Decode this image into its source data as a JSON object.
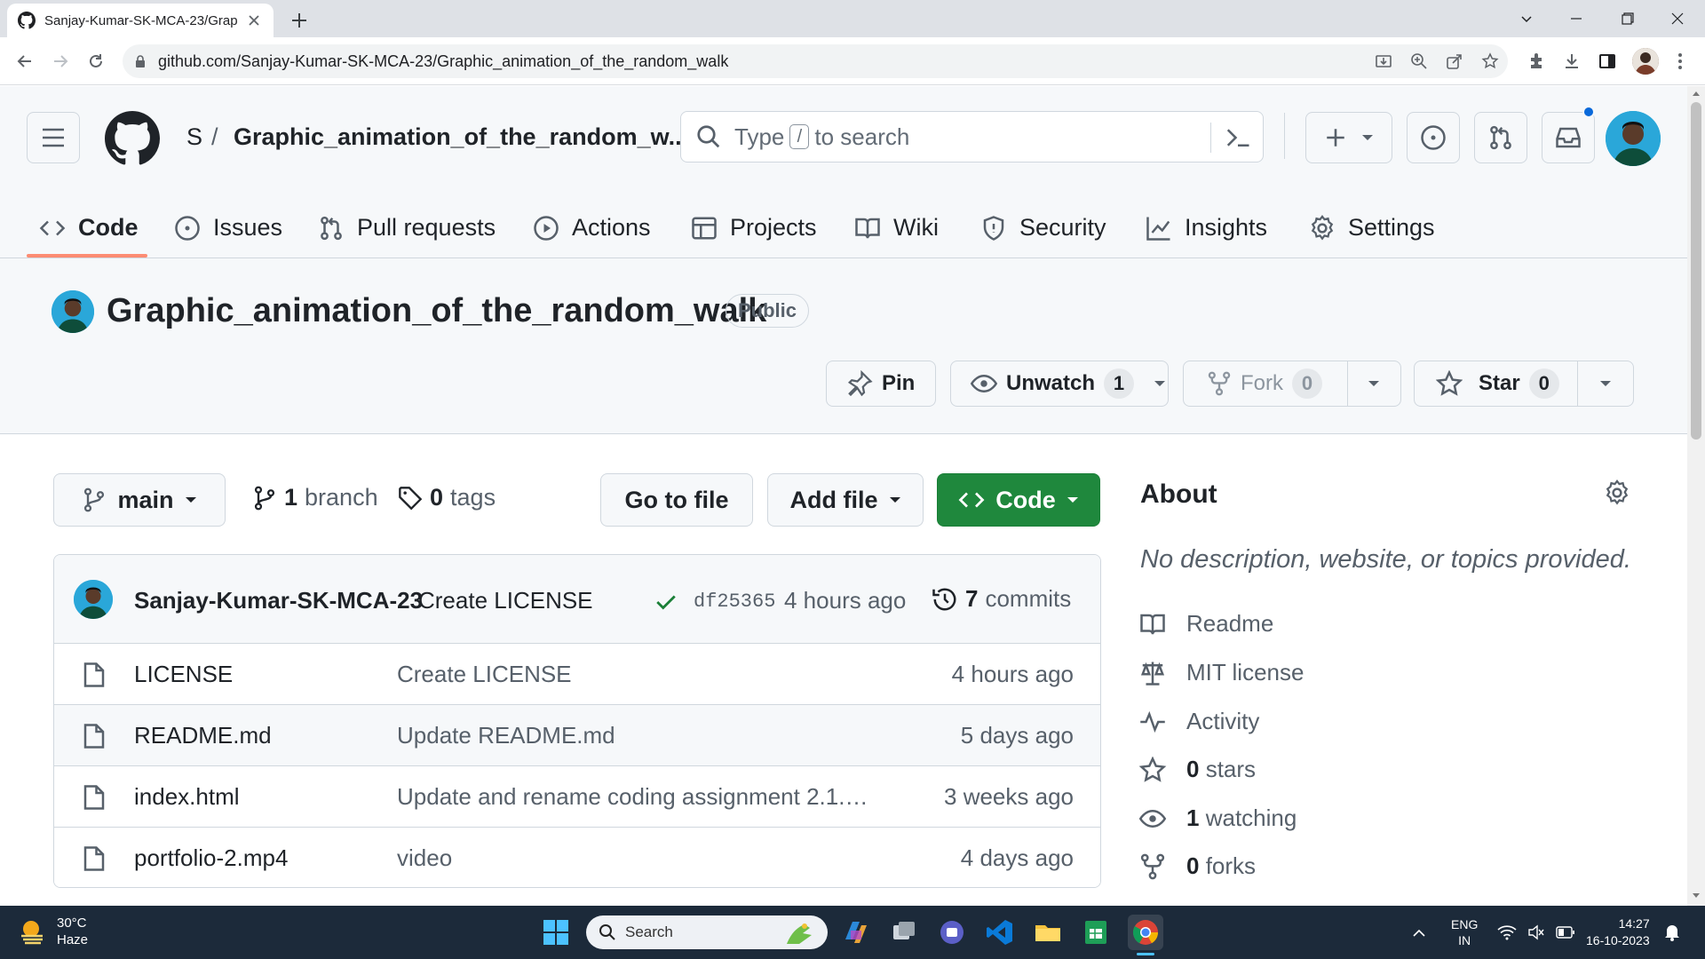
{
  "browser": {
    "tab_title": "Sanjay-Kumar-SK-MCA-23/Grap",
    "url": "github.com/Sanjay-Kumar-SK-MCA-23/Graphic_animation_of_the_random_walk"
  },
  "header": {
    "owner": "S",
    "separator": "/",
    "repo_short": "Graphic_animation_of_the_random_w...",
    "search_type": "Type",
    "search_key": "/",
    "search_rest": "to search"
  },
  "repo_nav": [
    {
      "label": "Code",
      "icon": "code-icon"
    },
    {
      "label": "Issues",
      "icon": "issue-icon"
    },
    {
      "label": "Pull requests",
      "icon": "pull-request-icon"
    },
    {
      "label": "Actions",
      "icon": "play-icon"
    },
    {
      "label": "Projects",
      "icon": "table-icon"
    },
    {
      "label": "Wiki",
      "icon": "book-icon"
    },
    {
      "label": "Security",
      "icon": "shield-icon"
    },
    {
      "label": "Insights",
      "icon": "graph-icon"
    },
    {
      "label": "Settings",
      "icon": "gear-icon"
    }
  ],
  "repo": {
    "name": "Graphic_animation_of_the_random_walk",
    "visibility": "Public",
    "pin_label": "Pin",
    "unwatch_label": "Unwatch",
    "watch_count": "1",
    "fork_label": "Fork",
    "fork_count": "0",
    "star_label": "Star",
    "star_count": "0"
  },
  "branch_bar": {
    "branch": "main",
    "branch_count": "1",
    "branch_label": "branch",
    "tag_count": "0",
    "tag_label": "tags",
    "goto_file": "Go to file",
    "add_file": "Add file",
    "code_btn": "Code"
  },
  "latest_commit": {
    "author": "Sanjay-Kumar-SK-MCA-23",
    "message": "Create LICENSE",
    "sha": "df25365",
    "time": "4 hours ago",
    "commit_count": "7",
    "commit_label": "commits"
  },
  "files": [
    {
      "name": "LICENSE",
      "message": "Create LICENSE",
      "time": "4 hours ago"
    },
    {
      "name": "README.md",
      "message": "Update README.md",
      "time": "5 days ago"
    },
    {
      "name": "index.html",
      "message": "Update and rename coding assignment 2.1.h...",
      "time": "3 weeks ago"
    },
    {
      "name": "portfolio-2.mp4",
      "message": "video",
      "time": "4 days ago"
    }
  ],
  "about": {
    "title": "About",
    "description": "No description, website, or topics provided.",
    "readme": "Readme",
    "license": "MIT license",
    "activity": "Activity",
    "stars_count": "0",
    "stars_label": "stars",
    "watching_count": "1",
    "watching_label": "watching",
    "forks_count": "0",
    "forks_label": "forks"
  },
  "taskbar": {
    "temp": "30°C",
    "weather": "Haze",
    "search": "Search",
    "lang_1": "ENG",
    "lang_2": "IN",
    "time": "14:27",
    "date": "16-10-2023"
  },
  "colors": {
    "accent_green": "#1f883d",
    "nav_underline": "#fd8c73",
    "notification_blue": "#0969da"
  }
}
